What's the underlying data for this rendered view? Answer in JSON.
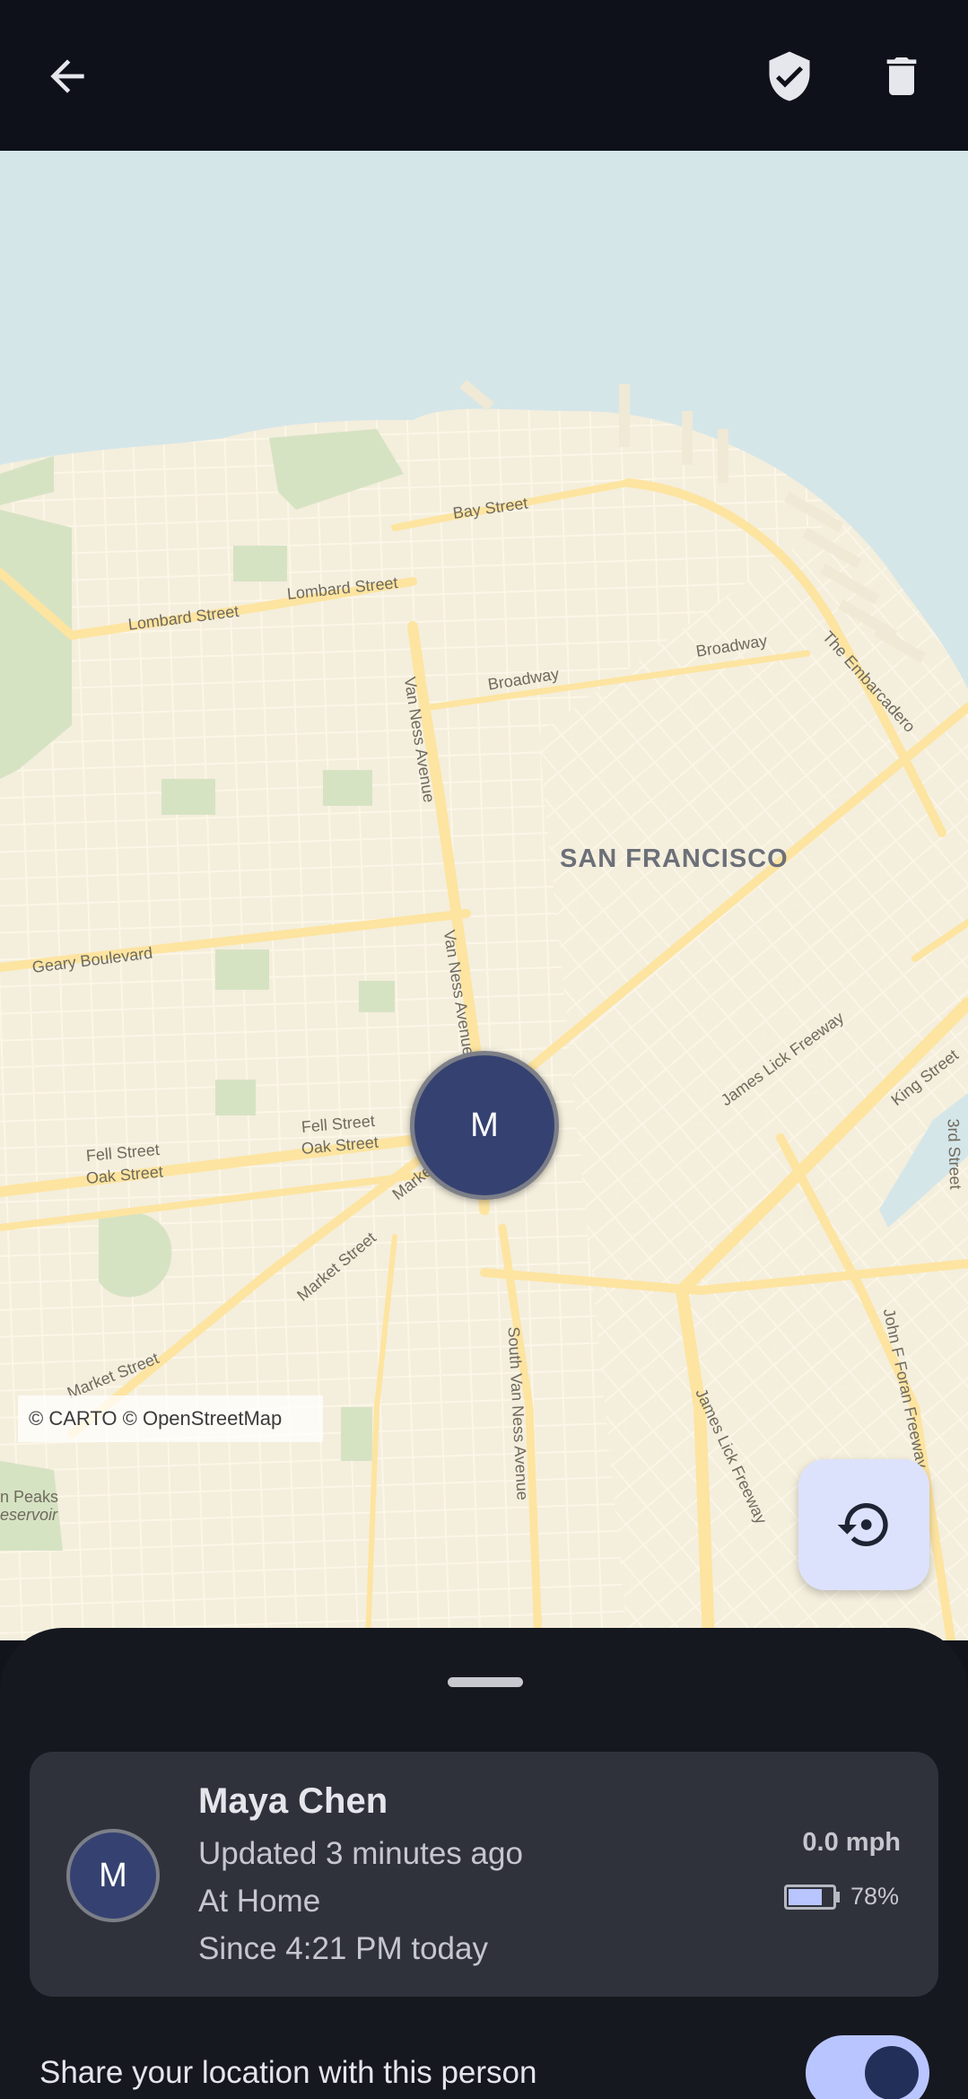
{
  "toolbar": {
    "back_icon": "arrow-left-icon",
    "shield_icon": "shield-check-icon",
    "delete_icon": "trash-icon"
  },
  "map": {
    "city_label": "SAN FRANCISCO",
    "street_labels": {
      "bay": "Bay Street",
      "lombard1": "Lombard Street",
      "lombard2": "Lombard Street",
      "broadway1": "Broadway",
      "broadway2": "Broadway",
      "embarcadero": "The Embarcadero",
      "van_ness1": "Van Ness Avenue",
      "van_ness2": "Van Ness Avenue",
      "geary": "Geary Boulevard",
      "fell1": "Fell Street",
      "oak1": "Oak Street",
      "fell2": "Fell Street",
      "oak2": "Oak Street",
      "market1": "Market Street",
      "market2": "Market Street",
      "market3": "Market",
      "south_van_ness": "South Van Ness Avenue",
      "james_lick1": "James Lick Freeway",
      "james_lick2": "James Lick Freeway",
      "king": "King Street",
      "third": "3rd Street",
      "john_f_foran": "John F Foran Freeway",
      "twin_peaks": "n Peaks",
      "reservoir": "eservoir"
    },
    "attribution": "© CARTO © OpenStreetMap",
    "marker_initial": "M",
    "history_button_icon": "history-icon"
  },
  "sheet": {
    "person": {
      "initial": "M",
      "name": "Maya Chen",
      "updated": "Updated 3 minutes ago",
      "place": "At Home",
      "since": "Since 4:21 PM today",
      "speed": "0.0 mph",
      "battery_percent_label": "78%",
      "battery_level": 0.78
    },
    "share_label": "Share your location with this person",
    "share_enabled": true
  },
  "colors": {
    "top_bar": "#0e111a",
    "sheet": "#161820",
    "card": "#30323b",
    "marker": "#354271",
    "accent": "#b9c5ff",
    "water": "#d5e6e9",
    "land": "#f4eedc",
    "road": "#fde7a6"
  }
}
